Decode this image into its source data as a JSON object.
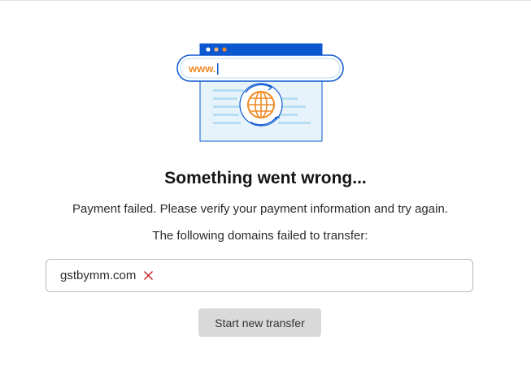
{
  "illustration": {
    "url_text": "www.",
    "accent_color": "#0b57d0",
    "highlight_color": "#f08a24",
    "icon": "globe-icon"
  },
  "error": {
    "title": "Something went wrong...",
    "message": "Payment failed. Please verify your payment information and try again.",
    "domains_heading": "The following domains failed to transfer:"
  },
  "failed_domains": [
    {
      "name": "gstbymm.com",
      "status_icon": "close-icon",
      "status_color": "#c5221f"
    }
  ],
  "actions": {
    "start_new_transfer_label": "Start new transfer"
  }
}
